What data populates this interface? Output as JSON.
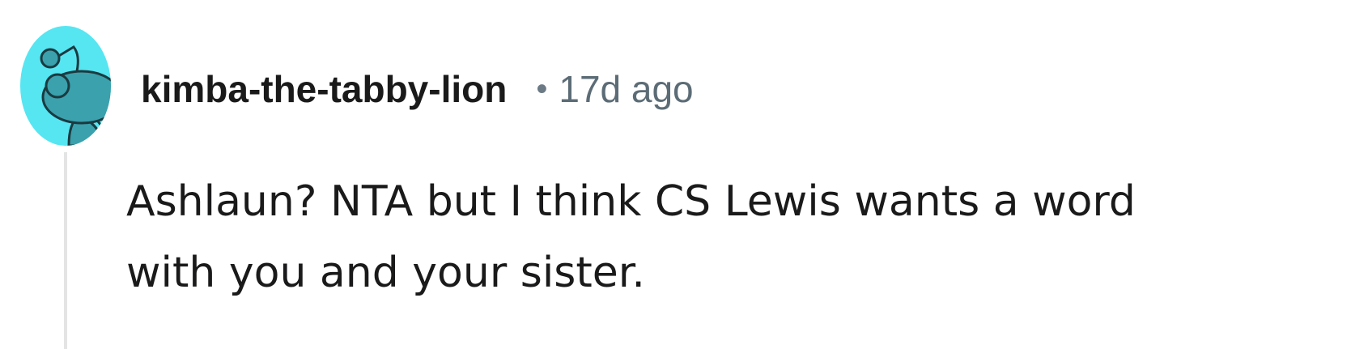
{
  "comment": {
    "username": "kimba-the-tabby-lion",
    "separator": "•",
    "timestamp": "17d ago",
    "body_line_1": "Ashlaun? NTA but I think CS Lewis wants a word",
    "body_line_2": "with you and your sister.",
    "avatar_icon": "snoo-avatar-icon",
    "colors": {
      "avatar_background": "#55e6f2",
      "avatar_figure": "#3aa1ad",
      "username": "#1a1a1b",
      "timestamp": "#5c6c76",
      "thread_line": "#e4e4e4"
    }
  }
}
